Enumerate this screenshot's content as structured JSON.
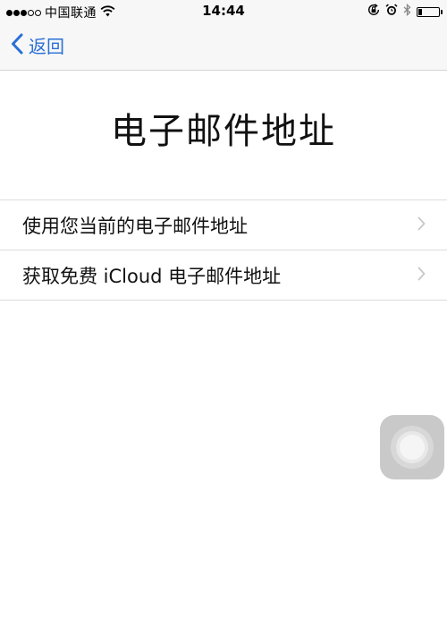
{
  "status_bar": {
    "signal_filled": 3,
    "signal_total": 5,
    "carrier": "中国联通",
    "wifi_icon": "wifi-icon",
    "time": "14:44",
    "icons": [
      "orientation-lock-icon",
      "alarm-icon",
      "bluetooth-icon",
      "battery-icon"
    ],
    "battery_level": 0.2
  },
  "nav": {
    "back_label": "返回",
    "back_icon": "chevron-left-icon"
  },
  "page": {
    "title": "电子邮件地址"
  },
  "options": [
    {
      "label": "使用您当前的电子邮件地址"
    },
    {
      "label": "获取免费 iCloud 电子邮件地址"
    }
  ],
  "colors": {
    "accent": "#2a6fd6",
    "bar_background": "#f7f7f7",
    "separator": "#dcdcdc",
    "chevron": "#c7c7cc"
  }
}
